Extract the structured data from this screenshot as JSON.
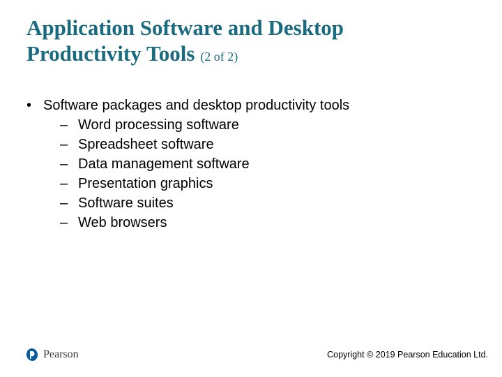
{
  "title": {
    "line1": "Application Software and Desktop",
    "line2": "Productivity Tools",
    "pager": "(2 of 2)"
  },
  "content": {
    "lead": "Software packages and desktop productivity tools",
    "items": [
      "Word processing software",
      "Spreadsheet software",
      "Data management software",
      "Presentation graphics",
      "Software suites",
      "Web browsers"
    ]
  },
  "footer": {
    "brand": "Pearson",
    "copyright": "Copyright © 2019 Pearson Education Ltd."
  }
}
